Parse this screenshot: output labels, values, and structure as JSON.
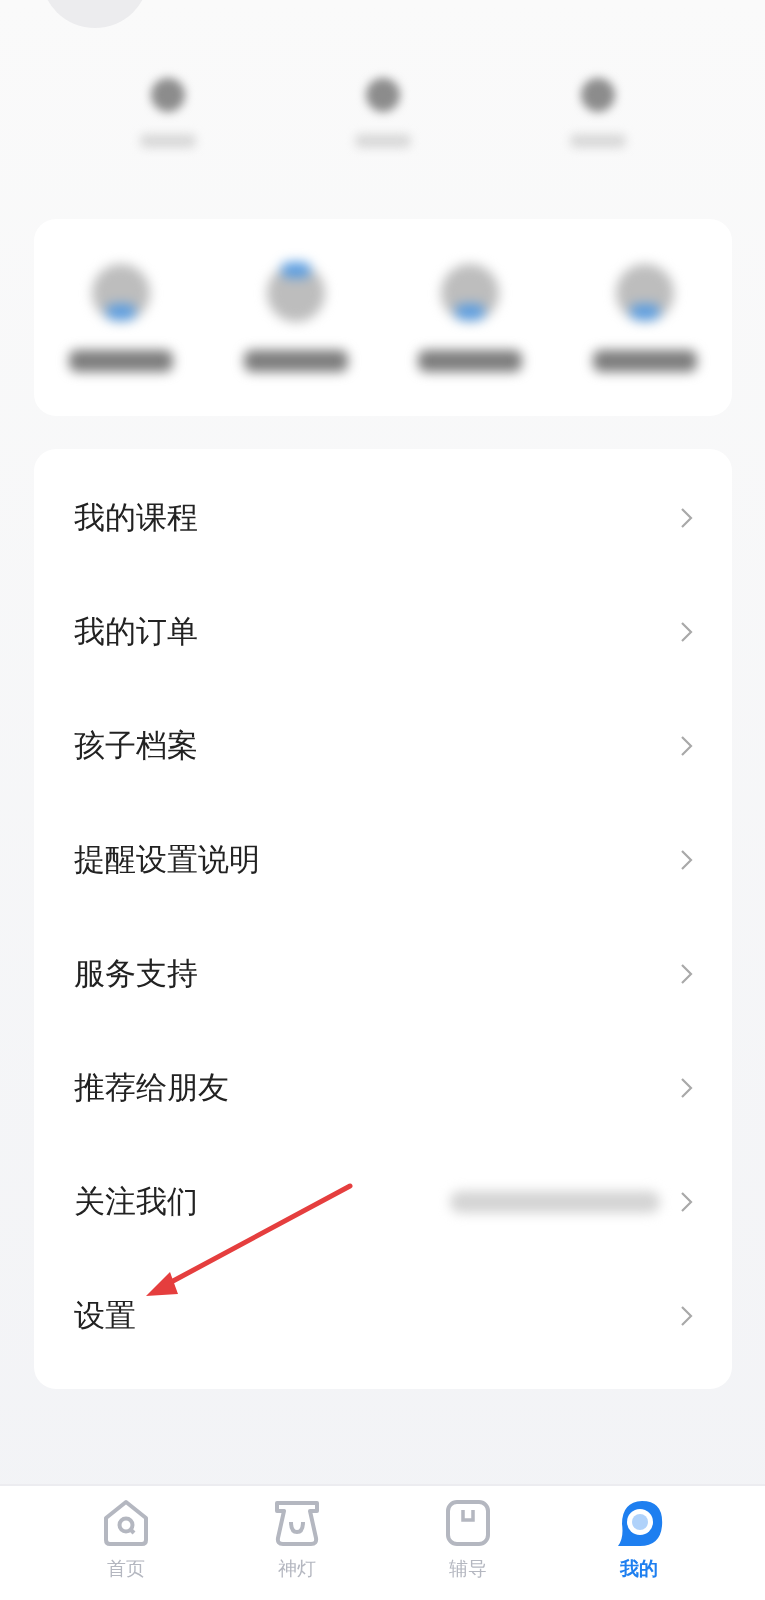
{
  "stats": [
    {
      "kind": "blurred"
    },
    {
      "kind": "blurred"
    },
    {
      "kind": "blurred"
    }
  ],
  "shortcuts": [
    {
      "kind": "blurred"
    },
    {
      "kind": "blurred"
    },
    {
      "kind": "blurred"
    },
    {
      "kind": "blurred"
    }
  ],
  "menu": [
    {
      "label": "我的课程"
    },
    {
      "label": "我的订单"
    },
    {
      "label": "孩子档案"
    },
    {
      "label": "提醒设置说明"
    },
    {
      "label": "服务支持"
    },
    {
      "label": "推荐给朋友"
    },
    {
      "label": "关注我们",
      "kind": "blurred-detail"
    },
    {
      "label": "设置"
    }
  ],
  "annotation": {
    "kind": "arrow",
    "color": "#e53e3e"
  },
  "tabs": [
    {
      "label": "首页",
      "selected": false
    },
    {
      "label": "神灯",
      "selected": false
    },
    {
      "label": "辅导",
      "selected": false
    },
    {
      "label": "我的",
      "selected": true
    }
  ]
}
